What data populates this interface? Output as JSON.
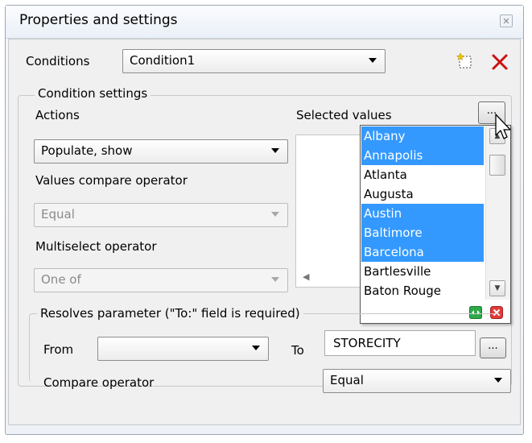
{
  "window": {
    "title": "Properties and settings",
    "close_glyph": "✕"
  },
  "conditions": {
    "label": "Conditions",
    "selected": "Condition1"
  },
  "condition_settings": {
    "group_title": "Condition settings",
    "actions_label": "Actions",
    "actions_value": "Populate, show",
    "values_compare_label": "Values compare operator",
    "values_compare_value": "Equal",
    "multiselect_label": "Multiselect operator",
    "multiselect_value": "One of",
    "selected_values_label": "Selected values",
    "dots_label": "...",
    "values_list": [
      {
        "text": "Albany",
        "selected": true
      },
      {
        "text": "Annapolis",
        "selected": true
      },
      {
        "text": "Atlanta",
        "selected": false
      },
      {
        "text": "Augusta",
        "selected": false
      },
      {
        "text": "Austin",
        "selected": true
      },
      {
        "text": "Baltimore",
        "selected": true
      },
      {
        "text": "Barcelona",
        "selected": true
      },
      {
        "text": "Bartlesville",
        "selected": false
      },
      {
        "text": "Baton Rouge",
        "selected": false
      }
    ]
  },
  "resolves": {
    "group_title": "Resolves parameter (\"To:\" field is required)",
    "from_label": "From",
    "from_value": "",
    "to_label": "To",
    "to_value": "STORECITY",
    "dots_label": "...",
    "compare_label": "Compare operator",
    "compare_value": "Equal"
  },
  "colors": {
    "selection": "#3399ff",
    "delete_red": "#cc1111",
    "ok_green": "#1f9a3a"
  },
  "icons": [
    "new-condition-icon",
    "delete-icon",
    "confirm-icon",
    "cancel-icon",
    "mouse-cursor-icon"
  ]
}
